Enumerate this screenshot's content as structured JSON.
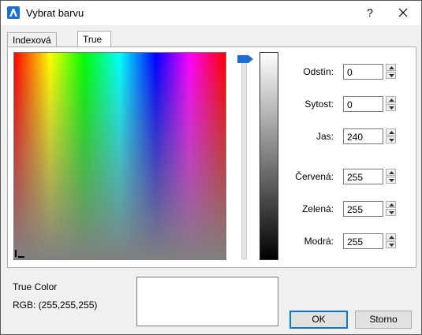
{
  "window": {
    "title": "Vybrat barvu",
    "help": "?",
    "accent": "#1f6fd1"
  },
  "tabs": [
    {
      "label": "Indexová barva",
      "active": false
    },
    {
      "label": "True Color",
      "active": true
    }
  ],
  "fields": {
    "hue": {
      "label": "Odstín:",
      "value": "0"
    },
    "saturation": {
      "label": "Sytost:",
      "value": "0"
    },
    "luminance": {
      "label": "Jas:",
      "value": "240"
    },
    "red": {
      "label": "Červená:",
      "value": "255"
    },
    "green": {
      "label": "Zelená:",
      "value": "255"
    },
    "blue": {
      "label": "Modrá:",
      "value": "255"
    }
  },
  "preview": {
    "mode_label": "True Color",
    "rgb_label": "RGB: (255,255,255)",
    "color": "#ffffff"
  },
  "buttons": {
    "ok": "OK",
    "cancel": "Storno"
  }
}
